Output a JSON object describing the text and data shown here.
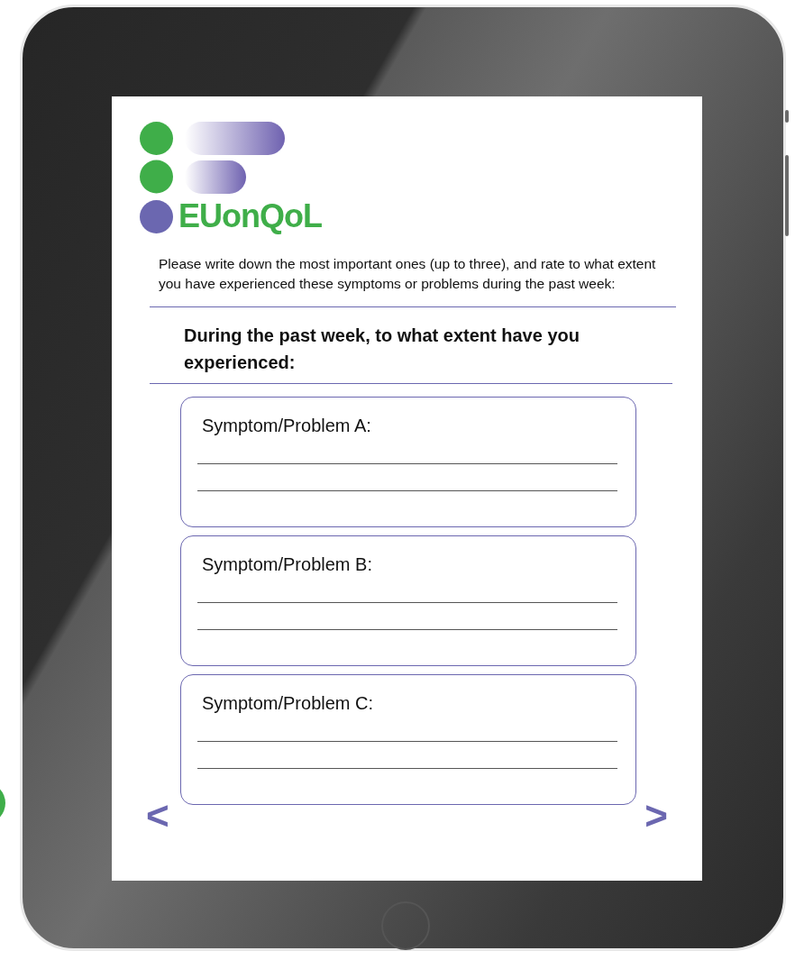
{
  "logo": {
    "text": "EUonQoL"
  },
  "instructions": "Please write down the most important ones (up to three), and rate to what extent you have experienced these symptoms or problems during the past week:",
  "question": "During the past week, to what extent have you experienced:",
  "symptoms": [
    {
      "label": "Symptom/Problem A:"
    },
    {
      "label": "Symptom/Problem B:"
    },
    {
      "label": "Symptom/Problem C:"
    }
  ],
  "navigation": {
    "previous": "<",
    "next": ">"
  }
}
